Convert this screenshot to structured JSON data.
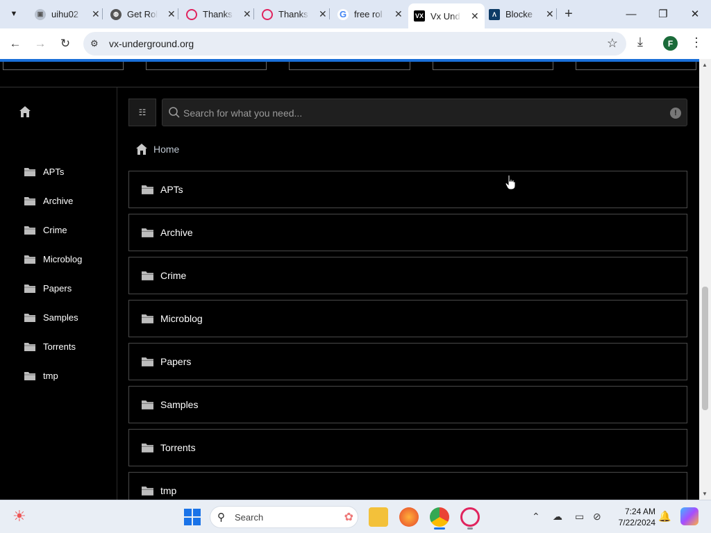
{
  "browser": {
    "tabs": [
      {
        "title": "uihu02",
        "favicon": "image-icon"
      },
      {
        "title": "Get Rol",
        "favicon": "globe-icon"
      },
      {
        "title": "Thanks",
        "favicon": "opera-icon"
      },
      {
        "title": "Thanks",
        "favicon": "opera-icon"
      },
      {
        "title": "free rol",
        "favicon": "google-icon"
      },
      {
        "title": "Vx Und",
        "favicon": "vx-icon",
        "favicon_text": "VX"
      },
      {
        "title": "Blocke",
        "favicon": "lambda-icon"
      }
    ],
    "tab_close_glyph": "✕",
    "new_tab_glyph": "+",
    "url": "vx-underground.org",
    "profile_initial": "F"
  },
  "page": {
    "search_placeholder": "Search for what you need...",
    "breadcrumb": "Home",
    "sidebar_items": [
      "APTs",
      "Archive",
      "Crime",
      "Microblog",
      "Papers",
      "Samples",
      "Torrents",
      "tmp"
    ],
    "folders": [
      "APTs",
      "Archive",
      "Crime",
      "Microblog",
      "Papers",
      "Samples",
      "Torrents",
      "tmp"
    ],
    "accent_color": "#1a6fd8"
  },
  "taskbar": {
    "search_label": "Search",
    "time": "7:24 AM",
    "date": "7/22/2024"
  }
}
